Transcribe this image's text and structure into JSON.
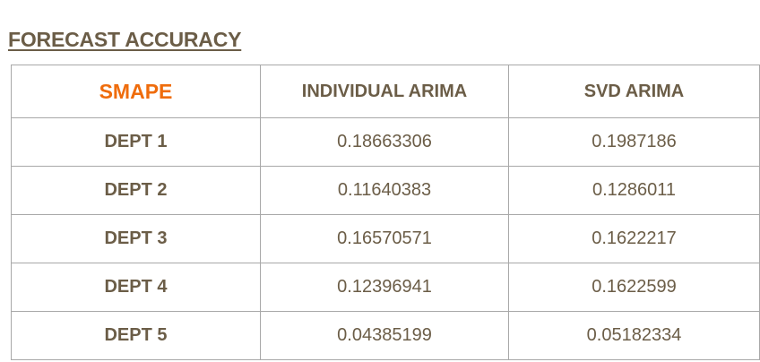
{
  "title": "FORECAST ACCURACY",
  "table": {
    "corner_label": "SMAPE",
    "columns": [
      "INDIVIDUAL ARIMA",
      "SVD ARIMA"
    ],
    "rows": [
      {
        "label": "DEPT 1",
        "individual_arima": "0.18663306",
        "svd_arima": "0.1987186"
      },
      {
        "label": "DEPT 2",
        "individual_arima": "0.11640383",
        "svd_arima": "0.1286011"
      },
      {
        "label": "DEPT 3",
        "individual_arima": "0.16570571",
        "svd_arima": "0.1622217"
      },
      {
        "label": "DEPT 4",
        "individual_arima": "0.12396941",
        "svd_arima": "0.1622599"
      },
      {
        "label": "DEPT 5",
        "individual_arima": "0.04385199",
        "svd_arima": "0.05182334"
      }
    ]
  },
  "colors": {
    "text": "#6b5d47",
    "accent": "#ef6c0c",
    "border": "#a8a8a8"
  }
}
